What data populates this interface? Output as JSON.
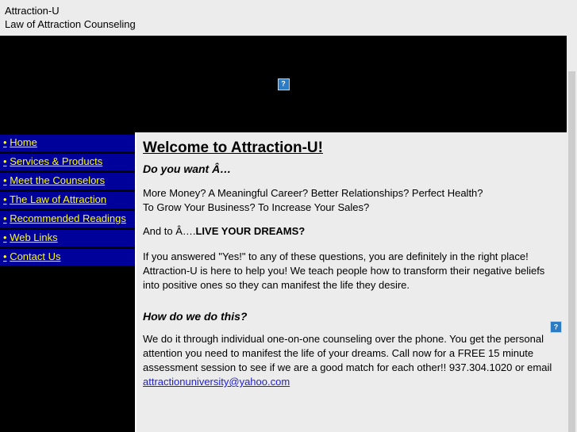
{
  "header": {
    "site_title": "Attraction-U",
    "tagline": "Law of Attraction Counseling"
  },
  "banner": {
    "image_alt": "broken-image"
  },
  "sidebar": {
    "bullet": "•",
    "items": [
      {
        "label": "Home"
      },
      {
        "label": "Services & Products"
      },
      {
        "label": "Meet the Counselors"
      },
      {
        "label": "The Law of Attraction"
      },
      {
        "label": "Recommended Readings"
      },
      {
        "label": "Web Links"
      },
      {
        "label": "Contact Us"
      }
    ]
  },
  "main": {
    "heading": "Welcome to Attraction-U!",
    "subheading_1": "Do you want Â…",
    "para_1": "More Money? A Meaningful Career? Better Relationships? Perfect Health?",
    "para_1b": "To Grow Your Business? To Increase Your Sales?",
    "para_2_prefix": "And to Â….",
    "para_2_strong": "LIVE YOUR DREAMS?",
    "para_3": "If you answered \"Yes!\" to any of these questions, you are definitely in the right place! Attraction-U is here to help you! We teach people how to transform their negative beliefs into positive ones so they can manifest the life they desire.",
    "subheading_2": "How do we do this?",
    "para_4": "We do it through individual one-on-one counseling over the phone.  You get the personal attention you need to manifest the life of your dreams. Call now for a FREE 15 minute assessment session to see if we are a good match for each other!!  937.304.1020 or email",
    "email_link": "attractionuniversity@yahoo.com"
  }
}
